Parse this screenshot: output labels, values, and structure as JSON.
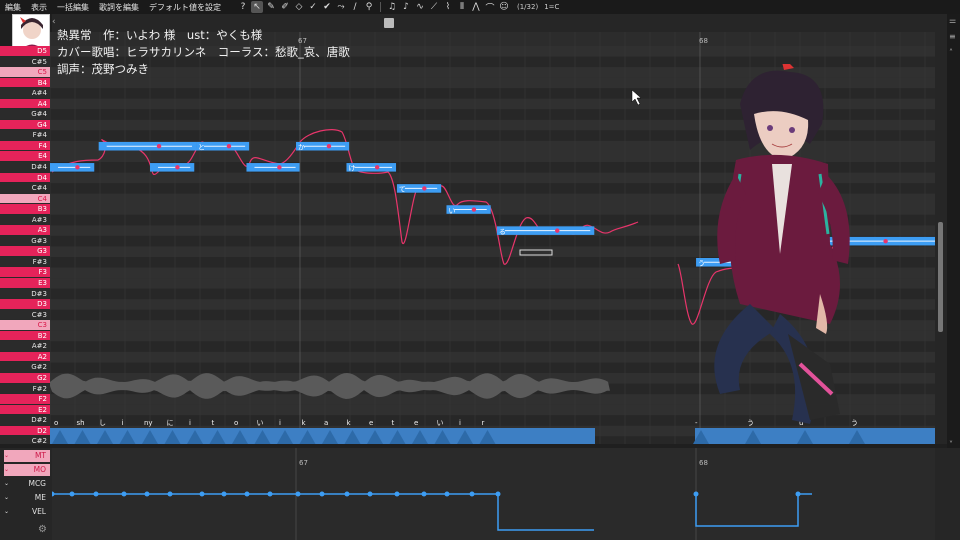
{
  "menu": [
    "編集",
    "表示",
    "一括編集",
    "歌詞を編集",
    "デフォルト値を設定"
  ],
  "toolbar": {
    "help": "?",
    "snap": "(1/32)",
    "key": "1=C"
  },
  "lyrics_overlay": [
    "熱異常　作：いよわ 様　ust：やくも様",
    "カバー歌唱：ヒラサカリンネ　コーラス：愁歌_哀、唐歌",
    "調声：茂野つみき"
  ],
  "measures": [
    "67",
    "68"
  ],
  "keys": [
    {
      "name": "D5",
      "t": "w"
    },
    {
      "name": "C#5",
      "t": "b"
    },
    {
      "name": "C5",
      "t": "c"
    },
    {
      "name": "B4",
      "t": "w"
    },
    {
      "name": "A#4",
      "t": "b"
    },
    {
      "name": "A4",
      "t": "w"
    },
    {
      "name": "G#4",
      "t": "b"
    },
    {
      "name": "G4",
      "t": "w"
    },
    {
      "name": "F#4",
      "t": "b"
    },
    {
      "name": "F4",
      "t": "w"
    },
    {
      "name": "E4",
      "t": "w"
    },
    {
      "name": "D#4",
      "t": "b"
    },
    {
      "name": "D4",
      "t": "w"
    },
    {
      "name": "C#4",
      "t": "b"
    },
    {
      "name": "C4",
      "t": "c"
    },
    {
      "name": "B3",
      "t": "w"
    },
    {
      "name": "A#3",
      "t": "b"
    },
    {
      "name": "A3",
      "t": "w"
    },
    {
      "name": "G#3",
      "t": "b"
    },
    {
      "name": "G3",
      "t": "w"
    },
    {
      "name": "F#3",
      "t": "b"
    },
    {
      "name": "F3",
      "t": "w"
    },
    {
      "name": "E3",
      "t": "w"
    },
    {
      "name": "D#3",
      "t": "b"
    },
    {
      "name": "D3",
      "t": "w"
    },
    {
      "name": "C#3",
      "t": "b"
    },
    {
      "name": "C3",
      "t": "c"
    },
    {
      "name": "B2",
      "t": "w"
    },
    {
      "name": "A#2",
      "t": "b"
    },
    {
      "name": "A2",
      "t": "w"
    },
    {
      "name": "G#2",
      "t": "b"
    },
    {
      "name": "G2",
      "t": "w"
    },
    {
      "name": "F#2",
      "t": "b"
    },
    {
      "name": "F2",
      "t": "w"
    },
    {
      "name": "E2",
      "t": "w"
    },
    {
      "name": "D#2",
      "t": "b"
    },
    {
      "name": "D2",
      "t": "w"
    },
    {
      "name": "C#2",
      "t": "b"
    }
  ],
  "notes": [
    {
      "lyric": "",
      "pitch": "D#4",
      "start": 0,
      "len": 0.05
    },
    {
      "lyric": "",
      "pitch": "F4",
      "start": 0.055,
      "len": 0.11
    },
    {
      "lyric": "",
      "pitch": "D#4",
      "start": 0.113,
      "len": 0.05
    },
    {
      "lyric": "と",
      "pitch": "F4",
      "start": 0.165,
      "len": 0.06
    },
    {
      "lyric": "",
      "pitch": "D#4",
      "start": 0.222,
      "len": 0.06
    },
    {
      "lyric": "か",
      "pitch": "F4",
      "start": 0.278,
      "len": 0.06
    },
    {
      "lyric": "け",
      "pitch": "D#4",
      "start": 0.335,
      "len": 0.056
    },
    {
      "lyric": "て",
      "pitch": "C#4",
      "start": 0.392,
      "len": 0.05
    },
    {
      "lyric": "い",
      "pitch": "B3",
      "start": 0.448,
      "len": 0.05
    },
    {
      "lyric": "る",
      "pitch": "A3",
      "start": 0.505,
      "len": 0.11
    },
    {
      "lyric": "う",
      "pitch": "F#3",
      "start": 0.73,
      "len": 0.115
    },
    {
      "lyric": "う",
      "pitch": "G#3",
      "start": 0.845,
      "len": 0.16
    }
  ],
  "phonemes": [
    "o",
    "sh",
    "し",
    "i",
    "ny",
    "に",
    "i",
    "t",
    "o",
    "い",
    "i",
    "k",
    "a",
    "k",
    "e",
    "t",
    "e",
    "い",
    "i",
    "r",
    "-",
    "う",
    "u",
    "う"
  ],
  "params": [
    {
      "label": "MT",
      "style": "pink"
    },
    {
      "label": "MO",
      "style": "pink"
    },
    {
      "label": "MCG",
      "style": "plain"
    },
    {
      "label": "ME",
      "style": "plain"
    },
    {
      "label": "VEL",
      "style": "plain"
    }
  ],
  "colors": {
    "accent": "#e5235a",
    "note": "#3d9df3",
    "pitch": "#e8356b"
  }
}
